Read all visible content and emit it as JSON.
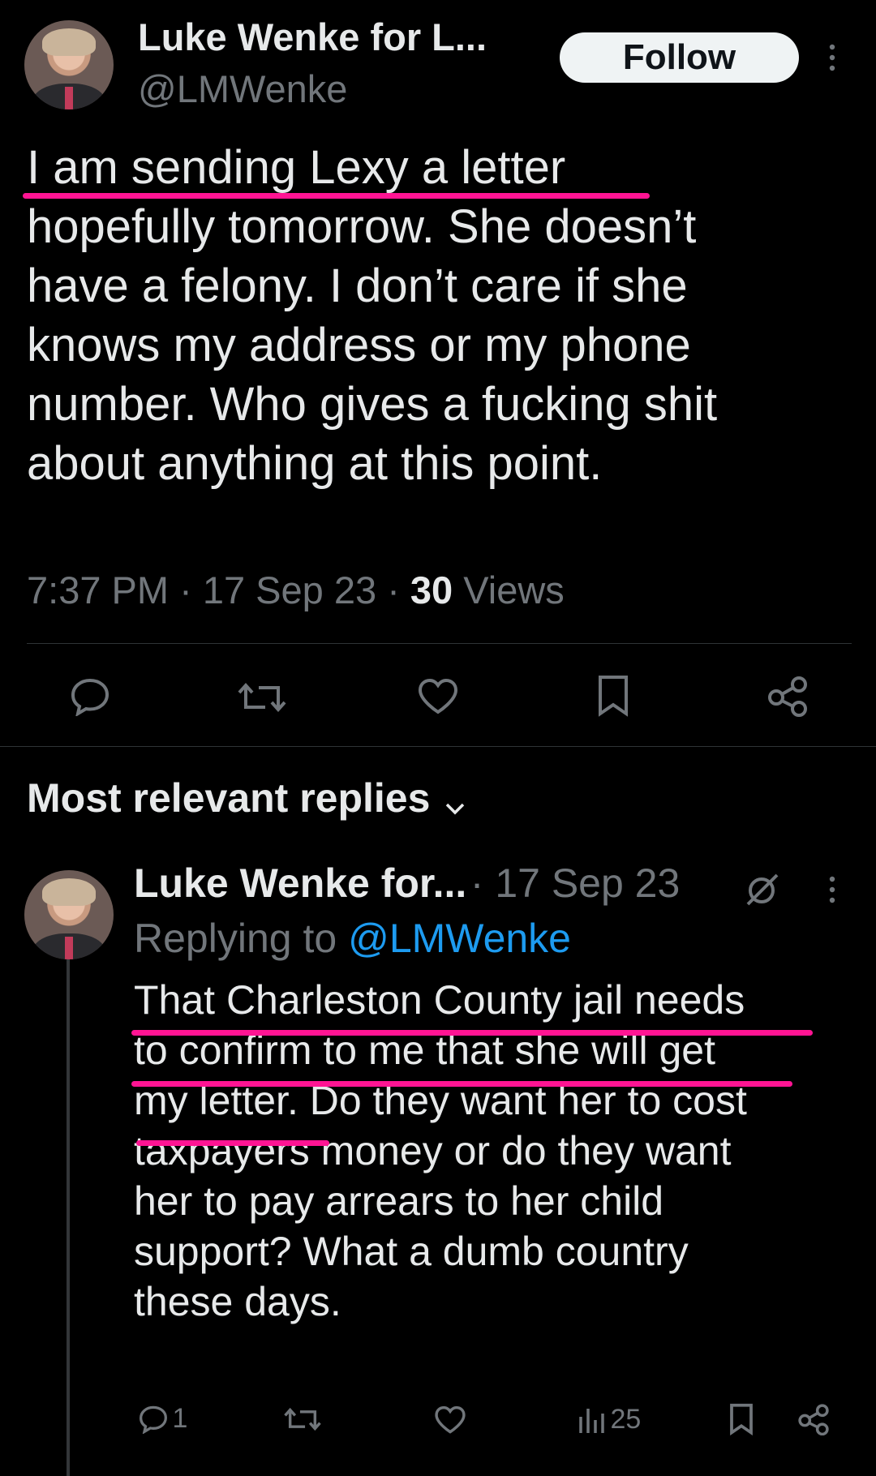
{
  "tweet": {
    "author_name": "Luke Wenke for L...",
    "handle": "@LMWenke",
    "follow_label": "Follow",
    "text_lines": [
      "I am sending Lexy a letter",
      "hopefully tomorrow.  She doesn’t",
      "have a felony.  I don’t care if she",
      "knows my address or my phone",
      "number.  Who gives a fucking shit",
      "about anything at this point."
    ],
    "time": "7:37 PM",
    "date": "17 Sep 23",
    "views_count": "30",
    "views_label": "Views"
  },
  "replies_header": "Most relevant replies",
  "reply": {
    "author_name": "Luke Wenke for...",
    "date": "17 Sep 23",
    "replying_to_label": "Replying to",
    "replying_to_handle": "@LMWenke",
    "text_lines": [
      "That Charleston County jail needs",
      "to confirm to me that she will get",
      "my letter.  Do they want her to cost",
      "taxpayers money or do they want",
      "her to pay arrears to her child",
      "support?  What a dumb country",
      "these days."
    ],
    "reply_count": "1",
    "views_count": "25"
  },
  "colors": {
    "background": "#000000",
    "text": "#e7e9ea",
    "secondary": "#71767b",
    "link": "#1d9bf0",
    "highlight_underline": "#ff1493"
  },
  "icons": [
    "reply-icon",
    "retweet-icon",
    "like-icon",
    "bookmark-icon",
    "share-icon",
    "views-icon",
    "more-icon",
    "grok-icon",
    "chevron-down-icon"
  ]
}
